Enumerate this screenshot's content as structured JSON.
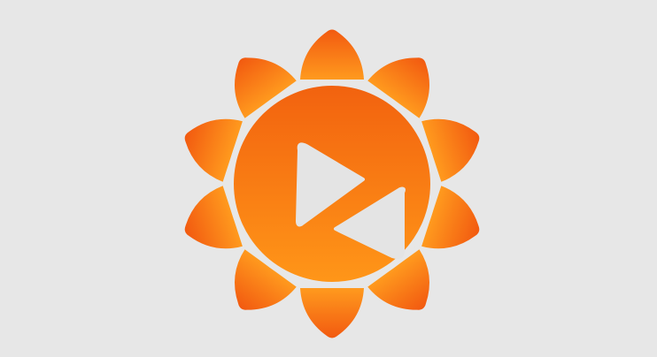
{
  "logo": {
    "icon": "sunflower-play-icon",
    "colors": {
      "background": "#e7e7e7",
      "orange_light": "#ff9a1e",
      "orange_dark": "#f25f12",
      "play_symbol": "#e4e4e4"
    }
  }
}
